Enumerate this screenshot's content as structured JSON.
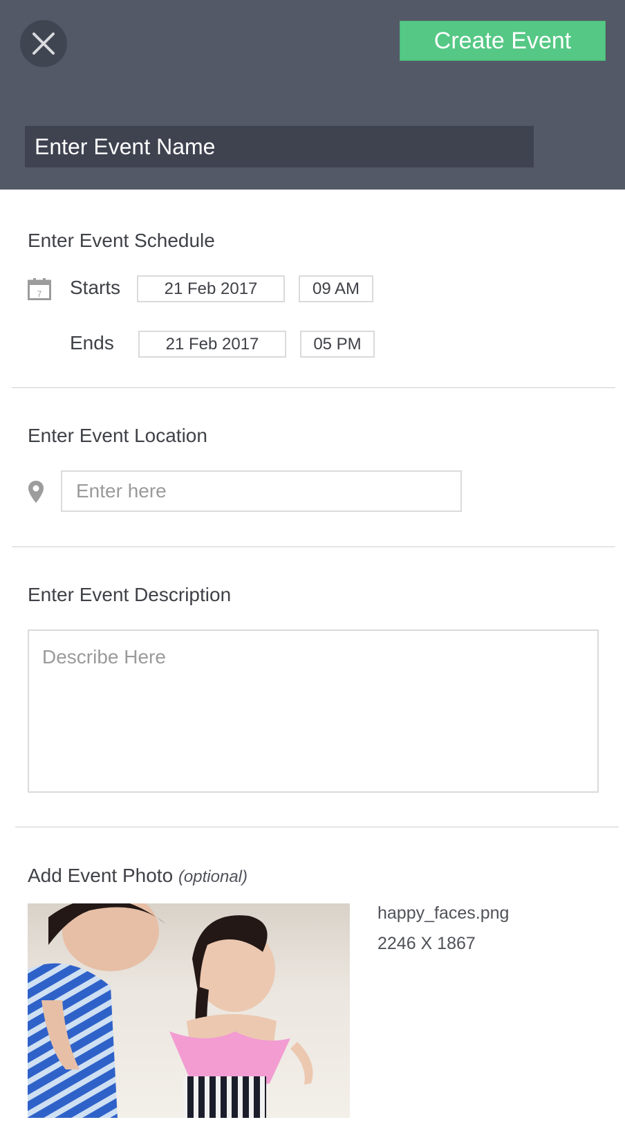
{
  "header": {
    "create_label": "Create Event",
    "event_name_placeholder": "Enter Event Name",
    "accent_color": "#55c885",
    "background_color": "#545967"
  },
  "schedule": {
    "title": "Enter Event Schedule",
    "starts_label": "Starts",
    "ends_label": "Ends",
    "start_date": "21 Feb 2017",
    "start_time": "09 AM",
    "end_date": "21 Feb 2017",
    "end_time": "05 PM",
    "calendar_day": "7"
  },
  "location": {
    "title": "Enter Event Location",
    "placeholder": "Enter here"
  },
  "description": {
    "title": "Enter Event Description",
    "placeholder": "Describe Here"
  },
  "photo": {
    "title": "Add Event Photo",
    "optional_label": "(optional)",
    "file_name": "happy_faces.png",
    "dimensions": "2246 X 1867"
  },
  "icons": {
    "close": "close-icon",
    "calendar": "calendar-icon",
    "location": "map-pin-icon"
  }
}
